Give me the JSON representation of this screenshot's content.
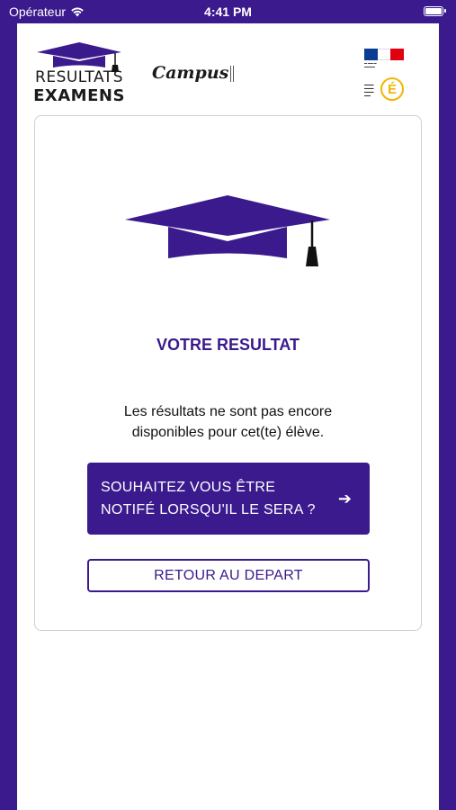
{
  "status_bar": {
    "carrier": "Opérateur",
    "time": "4:41 PM",
    "battery_level": 1.0
  },
  "header": {
    "brand_line1": "RESULTATS",
    "brand_line2": "EXAMENS",
    "partner": "Campus",
    "brand_color": "#3a1a8c",
    "gov_flag_colors": [
      "#0a3d91",
      "#ffffff",
      "#e1000f"
    ],
    "edu_accent": "#f2b600"
  },
  "result": {
    "title": "VOTRE RESULTAT",
    "message": "Les résultats ne sont pas encore disponibles pour cet(te) élève.",
    "notify_button": "SOUHAITEZ VOUS ÊTRE\nNOTIFÉ LORSQU'IL LE SERA ?",
    "back_button": "RETOUR AU DEPART"
  },
  "icons": {
    "wifi": "wifi-icon",
    "battery": "battery-icon",
    "arrow": "arrow-right-icon",
    "cap": "graduation-cap-icon"
  }
}
